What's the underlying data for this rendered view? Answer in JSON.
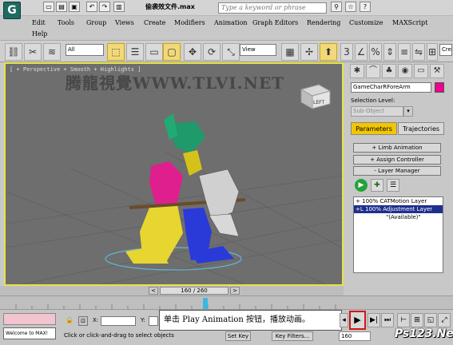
{
  "app": {
    "logo": "G",
    "file_name": "偷袭效文件.max",
    "search_placeholder": "Type a keyword or phrase"
  },
  "menu": [
    "Edit",
    "Tools",
    "Group",
    "Views",
    "Create",
    "Modifiers",
    "Animation",
    "Graph Editors",
    "Rendering",
    "Customize",
    "MAXScript",
    "Help"
  ],
  "toolbar": {
    "filter_value": "All",
    "view_value": "View"
  },
  "viewport": {
    "label": "[ + Perspective + Smooth + Highlights ]",
    "watermark": "腾龍視覺WWW.TLVI.NET",
    "cube_label": "LEFT"
  },
  "panel": {
    "object_name": "GameCharRForeArm",
    "object_color": "#ec008c",
    "selection_level_label": "Selection Level:",
    "sub_object_value": "Sub-Object",
    "tabs": [
      "Parameters",
      "Trajectories"
    ],
    "rollouts": [
      {
        "sign": "+",
        "label": "Limb Animation"
      },
      {
        "sign": "+",
        "label": "Assign Controller"
      },
      {
        "sign": "-",
        "label": "Layer Manager"
      }
    ],
    "layers": [
      {
        "prefix": "+",
        "text": "100% CATMotion Layer",
        "selected": false
      },
      {
        "prefix": "+L",
        "text": "100% Adjustment Layer",
        "selected": true
      },
      {
        "prefix": "",
        "text": "\"(Available)\"",
        "selected": false
      }
    ]
  },
  "timeline": {
    "slider_text": "160 / 260"
  },
  "status": {
    "welcome": "Welcome to MAX!",
    "prompt": "Click or click-and-drag to select objects",
    "x_label": "X:",
    "y_label": "Y:",
    "set_key": "Set Key",
    "key_filters": "Key Filters...",
    "frame": "160"
  },
  "callout": {
    "text": "单击 Play Animation 按钮，播放动画。"
  },
  "footer_logo": "Ps123.Net"
}
